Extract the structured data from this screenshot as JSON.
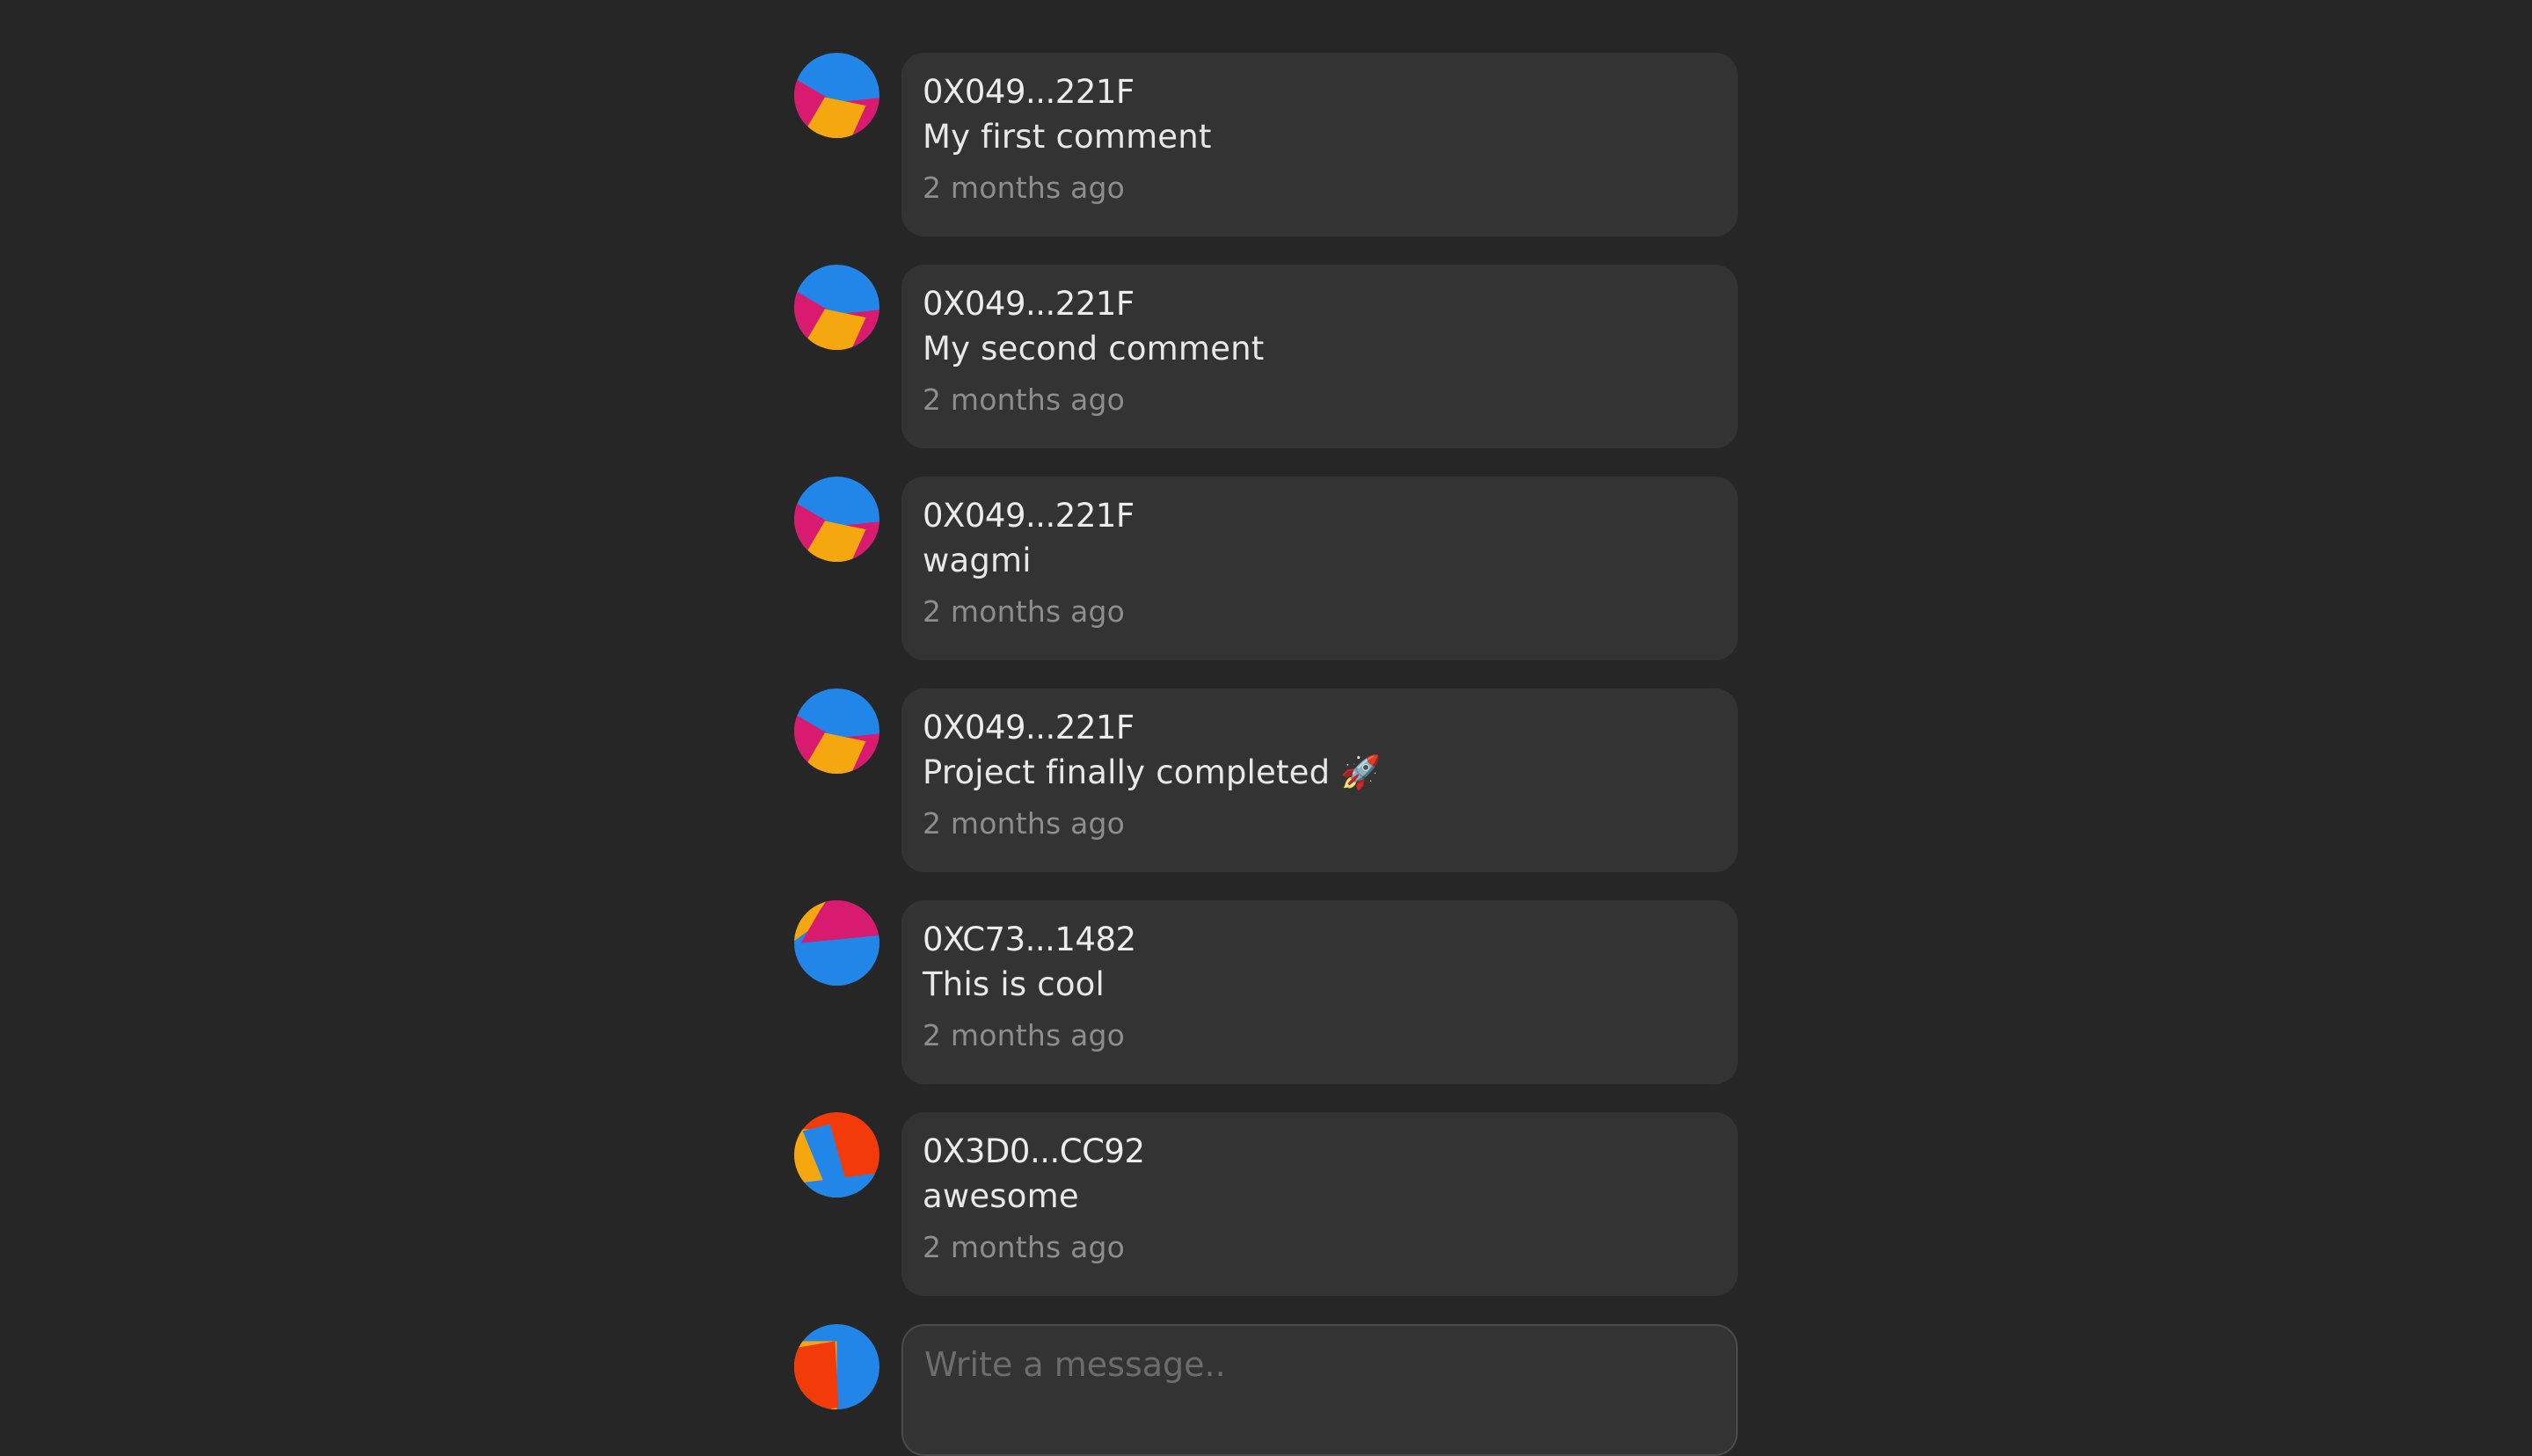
{
  "comments": [
    {
      "author": "0X049...221F",
      "text": "My first comment",
      "time": "2 months ago",
      "avatar": "avatar-a"
    },
    {
      "author": "0X049...221F",
      "text": "My second comment",
      "time": "2 months ago",
      "avatar": "avatar-a"
    },
    {
      "author": "0X049...221F",
      "text": "wagmi",
      "time": "2 months ago",
      "avatar": "avatar-a"
    },
    {
      "author": "0X049...221F",
      "text": "Project finally completed 🚀",
      "time": "2 months ago",
      "avatar": "avatar-a"
    },
    {
      "author": "0XC73...1482",
      "text": "This is cool",
      "time": "2 months ago",
      "avatar": "avatar-b"
    },
    {
      "author": "0X3D0...CC92",
      "text": "awesome",
      "time": "2 months ago",
      "avatar": "avatar-c"
    }
  ],
  "composer": {
    "placeholder": "Write a message..",
    "avatar": "avatar-d"
  },
  "colors": {
    "background": "#262626",
    "card": "#333333",
    "avatar_blue": "#2186E8",
    "avatar_pink": "#D81B6E",
    "avatar_yellow": "#F5A70F",
    "avatar_orange": "#F33B0A"
  }
}
